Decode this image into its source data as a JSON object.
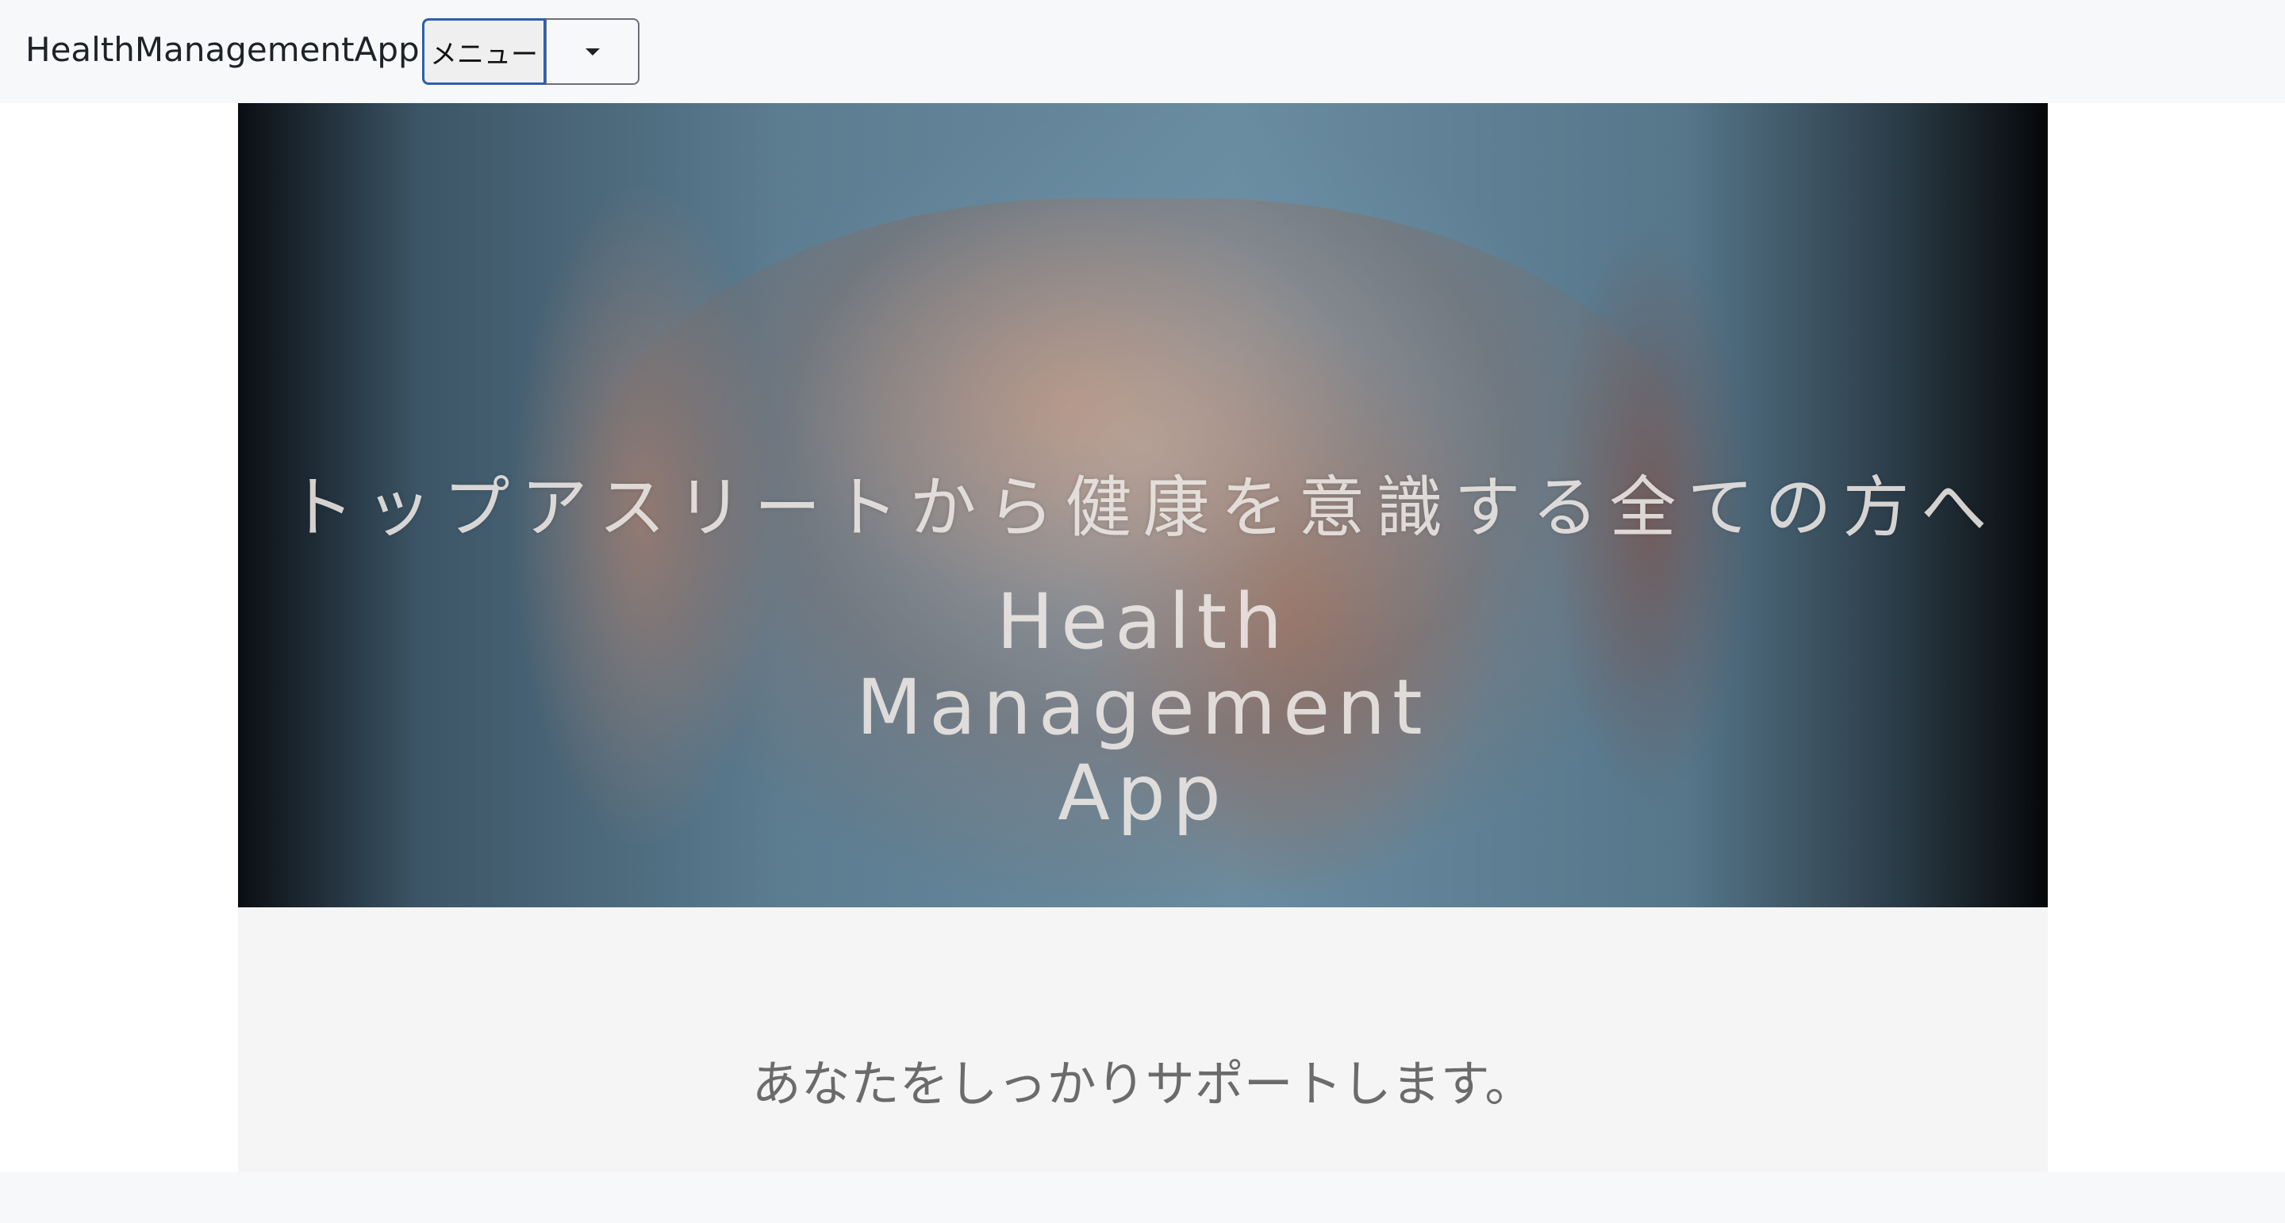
{
  "navbar": {
    "brand": "HealthManagementApp",
    "menu_label": "メニュー",
    "caret_icon": "caret-down-icon"
  },
  "hero": {
    "tagline": "トップアスリートから健康を意識する全ての方へ",
    "title_lines": [
      "Health",
      "Management",
      "App"
    ],
    "image": "muscular-torso-photo"
  },
  "support": {
    "text": "あなたをしっかりサポートします。"
  },
  "colors": {
    "navbar_bg": "#f7f8fa",
    "menu_button_border": "#2d5fb0",
    "support_bg": "#f5f5f5",
    "support_text": "#6b6b6b"
  }
}
